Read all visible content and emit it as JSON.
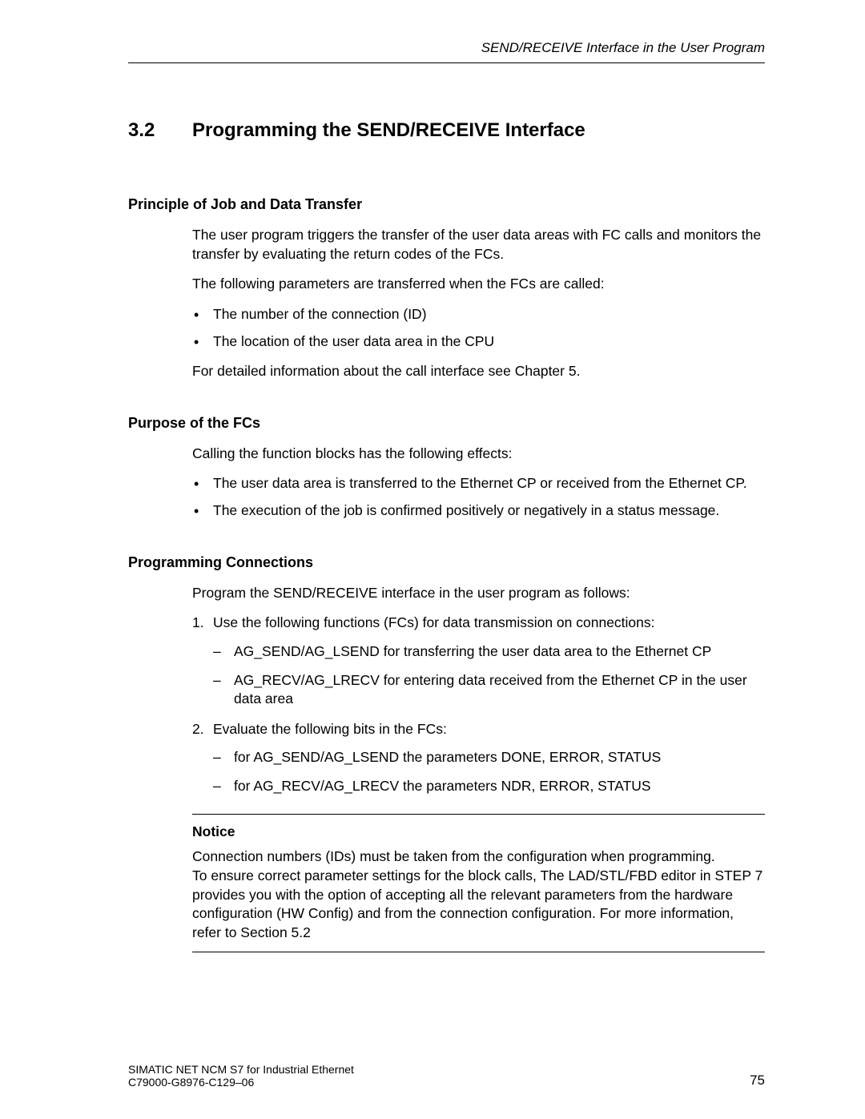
{
  "running_head": "SEND/RECEIVE Interface in the User Program",
  "section": {
    "number": "3.2",
    "title": "Programming the SEND/RECEIVE Interface"
  },
  "s1": {
    "heading": "Principle of Job and Data Transfer",
    "p1": "The user program triggers the transfer of the user data areas with FC calls and monitors the transfer by evaluating the return codes of the FCs.",
    "p2": "The following parameters are transferred when the FCs are called:",
    "b1": "The number of the connection (ID)",
    "b2": "The location of the user data area in the CPU",
    "p3": "For detailed information about the call interface see Chapter 5."
  },
  "s2": {
    "heading": "Purpose of the FCs",
    "p1": "Calling the function blocks has the following effects:",
    "b1": "The user data area is transferred to the Ethernet CP or received from the Ethernet CP.",
    "b2": "The execution of the job is confirmed positively or negatively in a status message."
  },
  "s3": {
    "heading": "Programming Connections",
    "p1": "Program the SEND/RECEIVE interface in the user program as follows:",
    "n1": "Use the following functions (FCs) for data transmission on connections:",
    "n1d1": "AG_SEND/AG_LSEND for transferring the user data area to the Ethernet CP",
    "n1d2": "AG_RECV/AG_LRECV for entering data received from the Ethernet CP in the user data area",
    "n2": "Evaluate the following bits in the FCs:",
    "n2d1": "for AG_SEND/AG_LSEND the parameters DONE, ERROR, STATUS",
    "n2d2": "for AG_RECV/AG_LRECV the parameters NDR, ERROR, STATUS"
  },
  "notice": {
    "title": "Notice",
    "p1": "Connection numbers (IDs) must be taken from the configuration when programming.",
    "p2": "To ensure correct parameter settings for the block calls, The LAD/STL/FBD editor in STEP 7 provides you with the option of accepting all the relevant parameters from the hardware configuration (HW Config) and from the connection configuration. For more information, refer to Section 5.2"
  },
  "footer": {
    "line1": "SIMATIC NET NCM S7 for Industrial Ethernet",
    "line2": "C79000-G8976-C129–06",
    "page": "75"
  }
}
